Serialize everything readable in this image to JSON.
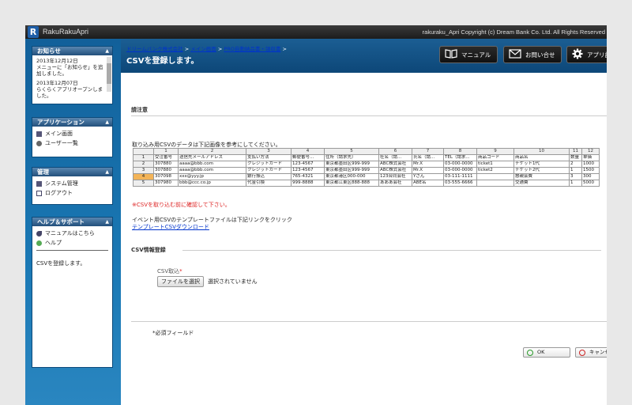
{
  "app": {
    "logo_letter": "R",
    "name": "RakuRakuApri",
    "copyright": "rakuraku_Apri Copyright (c) Dream Bank Co. Ltd. All Rights Reserved"
  },
  "sidebar": {
    "news": {
      "title": "お知らせ",
      "items": [
        {
          "date": "2013年12月12日",
          "text": "メニューに「お知らせ」を追加しました。"
        },
        {
          "date": "2013年12月07日",
          "text": "らくらくアプリオープンしました。"
        }
      ]
    },
    "application": {
      "title": "アプリケーション",
      "items": [
        "メイン画面",
        "ユーザー一覧"
      ]
    },
    "admin": {
      "title": "管理",
      "items": [
        "システム管理",
        "ログアウト"
      ]
    },
    "help": {
      "title": "ヘルプ＆サポート",
      "items": [
        "マニュアルはこちら",
        "ヘルプ"
      ],
      "description": "CSVを登録します。"
    }
  },
  "header": {
    "breadcrumb": [
      "ドリームバンク株式会社",
      "メイン画面",
      "PRO自動納品書・領収書"
    ],
    "separator": ">",
    "title": "CSVを登録します。",
    "buttons": {
      "manual": "マニュアル",
      "contact": "お問い合せ",
      "settings": "アプリ設定"
    }
  },
  "notes": {
    "heading": "請注意",
    "instruction": "取り込み用CSVのデータは下記画像を参考にしてください。",
    "warning": "※CSVを取り込む前に確認して下さい。",
    "template_text": "イベント用CSVのテンプレートファイルは下記リンクをクリック",
    "template_link": "テンプレートCSVダウンロード"
  },
  "csv_table": {
    "col_numbers": [
      "1",
      "2",
      "3",
      "4",
      "5",
      "6",
      "7",
      "8",
      "9",
      "10",
      "11",
      "12"
    ],
    "headers": [
      "受注番号",
      "送信先メールアドレス",
      "支払い方法",
      "郵便番号...",
      "住所（請求先）",
      "社名（請...",
      "氏名（請...",
      "TEL（請求...",
      "商品コード",
      "商品名",
      "数量",
      "単価"
    ],
    "rows": [
      {
        "num": "2",
        "cells": [
          "307880",
          "aaaa@bbb.com",
          "クレジットカード",
          "123-4567",
          "東京都墨田区999-999",
          "ABC株式会社",
          "Mr.X",
          "03-000-0000",
          "ticket1",
          "チケット1代",
          "2",
          "1000"
        ]
      },
      {
        "num": "3",
        "cells": [
          "307880",
          "aaaa@bbb.com",
          "クレジットカード",
          "123-4567",
          "東京都墨田区999-999",
          "ABC株式会社",
          "Mr.X",
          "03-000-0000",
          "ticket2",
          "チケット2代",
          "1",
          "1500"
        ]
      },
      {
        "num": "4",
        "cells": [
          "307098",
          "xxx@yyy.jp",
          "銀行振込",
          "765-4321",
          "東京都港区000-000",
          "123合同会社",
          "Yさん",
          "03-111-1111",
          "",
          "懇親会費",
          "3",
          "300"
        ]
      },
      {
        "num": "5",
        "cells": [
          "307980",
          "bbb@ccc.co.jp",
          "代金引換",
          "999-8888",
          "東京都江東区888-888",
          "あああ会社",
          "ABE名",
          "03-555-6666",
          "",
          "交通費",
          "1",
          "5000"
        ]
      }
    ],
    "header_row_num": "1"
  },
  "csv_register": {
    "heading": "CSV情報登録",
    "label": "CSV取込",
    "required_mark": "*",
    "file_button": "ファイルを選択",
    "file_status": "選択されていません"
  },
  "footer": {
    "required_note": "*必須フィールド",
    "ok": "OK",
    "cancel": "キャンセル"
  },
  "colors": {
    "header_blue": "#0d4778",
    "sidebar_blue": "#1a78b4",
    "selected_row": "#f3b458",
    "warning_red": "#dd2222"
  }
}
